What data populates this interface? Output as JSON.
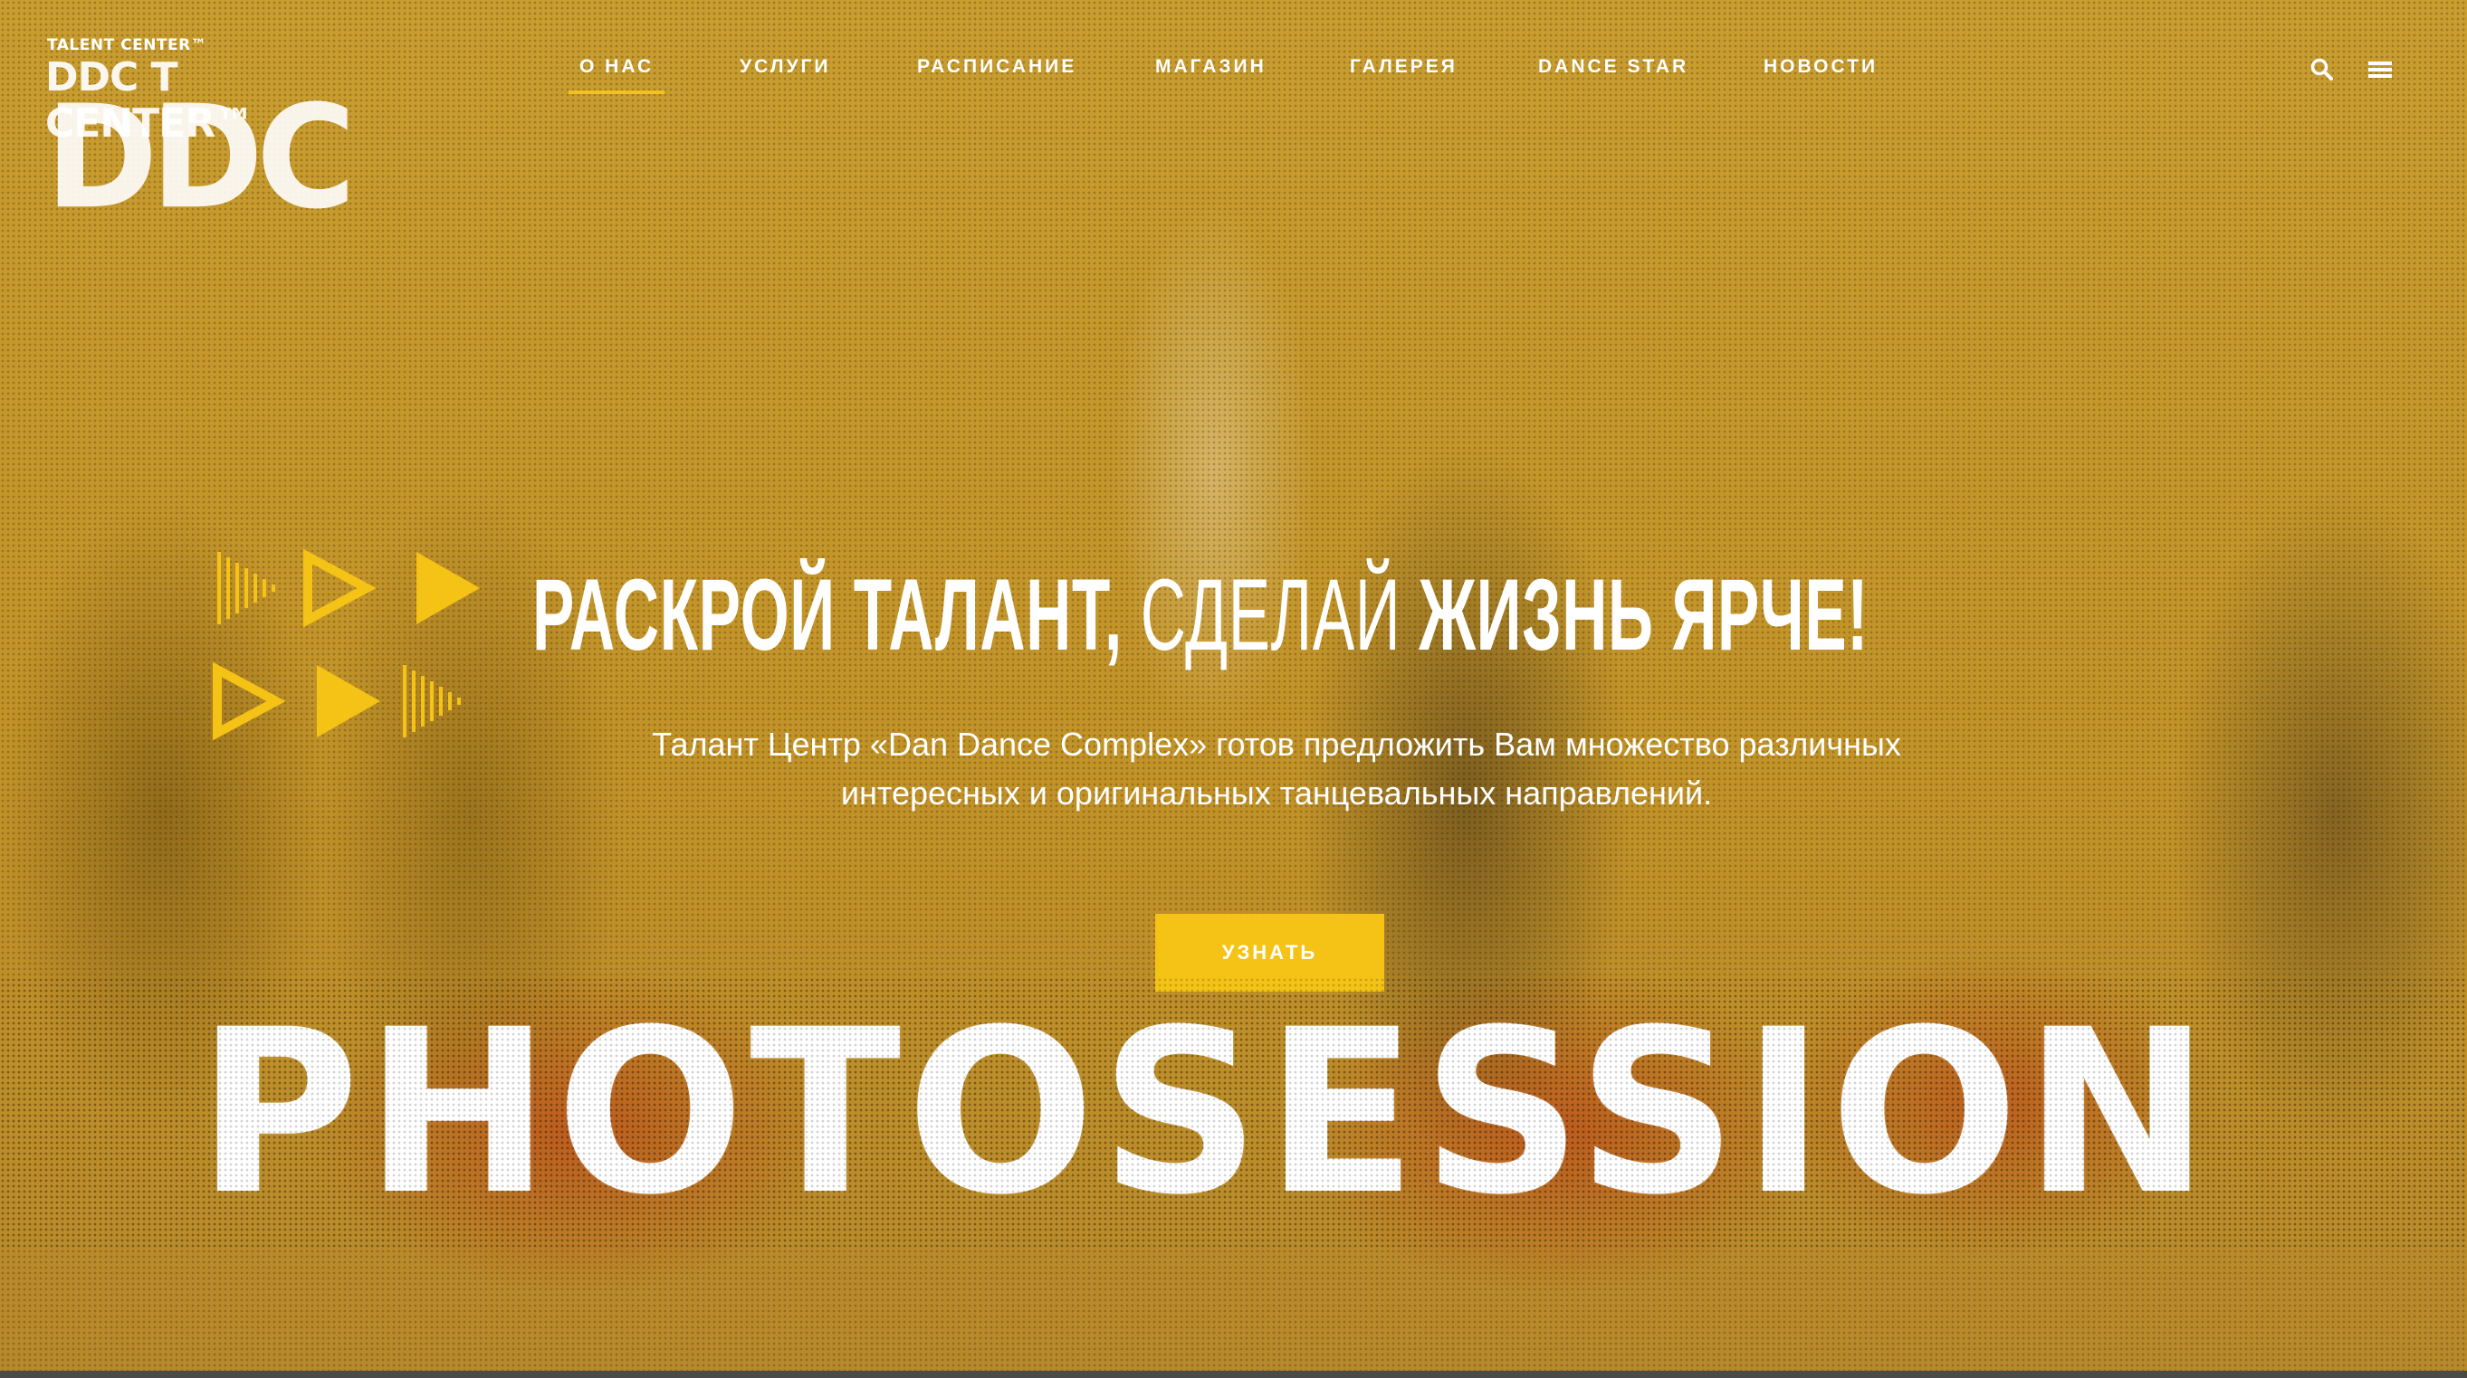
{
  "logo": {
    "small": "TALENT CENTER™",
    "mid": "DDC T CENTER™",
    "big": "DDC"
  },
  "nav": {
    "items": [
      {
        "label": "О НАС",
        "active": true
      },
      {
        "label": "УСЛУГИ",
        "active": false
      },
      {
        "label": "РАСПИСАНИЕ",
        "active": false
      },
      {
        "label": "МАГАЗИН",
        "active": false
      },
      {
        "label": "ГАЛЕРЕЯ",
        "active": false
      },
      {
        "label": "DANCE STAR",
        "active": false
      },
      {
        "label": "НОВОСТИ",
        "active": false
      }
    ],
    "search_icon": "search-icon",
    "menu_icon": "hamburger-menu-icon"
  },
  "hero": {
    "headline_part1": "РАСКРОЙ ТАЛАНТ,",
    "headline_part2": " СДЕЛАЙ ",
    "headline_part3": "ЖИЗНЬ ЯРЧЕ!",
    "subtitle_line1": "Талант Центр «Dan Dance Complex» готов предложить Вам множество различных",
    "subtitle_line2": "интересных и оригинальных танцевальных направлений.",
    "cta_label": "УЗНАТЬ",
    "big_word": "PHOTOSESSION"
  },
  "colors": {
    "accent": "#f4c315",
    "overlay": "#c4982b",
    "text": "#ffffff"
  }
}
